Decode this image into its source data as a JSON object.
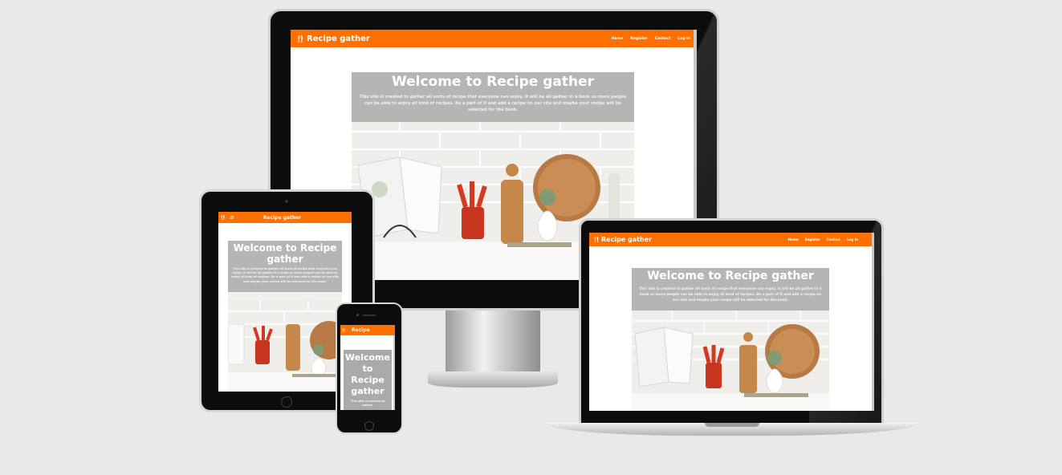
{
  "site": {
    "brand": "Recipe gather",
    "brand_short": "Recipe",
    "nav_links": [
      "Home",
      "Register",
      "Contact",
      "Log In"
    ],
    "hero_title": "Welcome to Recipe gather",
    "hero_body": "This site is created to gather all sorts of recipe that everyone can enjoy. It will be all gather in a book so more people can be able to enjoy all kind of recipes. Be a part of it and add a recipe on our site and maybe your recipe will be selected for the book.",
    "hero_body_mobile": "This site is created to gather"
  },
  "icons": {
    "brand": "fork-knife-icon",
    "menu": "hamburger-menu-icon"
  },
  "colors": {
    "brand": "#ff7000",
    "background": "#e9e9e9",
    "hero_overlay": "#aaaaaa"
  }
}
